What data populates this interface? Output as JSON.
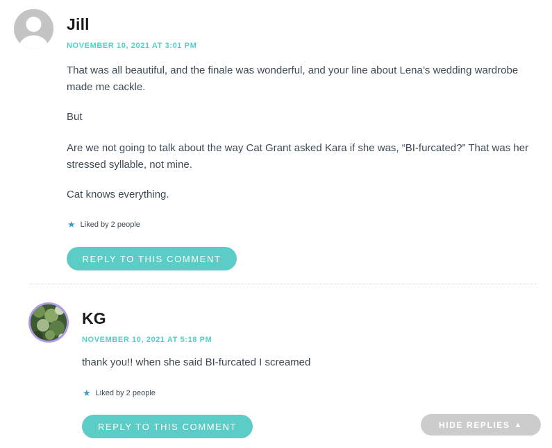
{
  "comments": [
    {
      "author": "Jill",
      "timestamp": "NOVEMBER 10, 2021 AT 3:01 PM",
      "paragraphs": [
        "That was all beautiful, and the finale was wonderful, and your line about Lena’s wedding wardrobe",
        "made me cackle.",
        "But",
        "Are we not going to talk about the way Cat Grant asked Kara if she was, “BI-furcated?” That was her",
        "stressed syllable, not mine.",
        "Cat knows everything."
      ],
      "likes": "Liked by 2 people",
      "reply_label": "REPLY TO THIS COMMENT"
    },
    {
      "author": "KG",
      "timestamp": "NOVEMBER 10, 2021 AT 5:18 PM",
      "paragraphs": [
        "thank you!! when she said BI-furcated I screamed"
      ],
      "likes": "Liked by 2 people",
      "reply_label": "REPLY TO THIS COMMENT"
    }
  ],
  "hide_replies_label": "HIDE REPLIES",
  "hide_replies_icon": "▲",
  "like_icon": "★",
  "colors": {
    "accent": "#5bcdc6",
    "timestamp": "#4fcfc7",
    "text": "#3d4a55",
    "author": "#1a1a1a",
    "star": "#3d9ec9",
    "hide_button": "#cccccc",
    "avatar_ring": "#b29be8"
  }
}
